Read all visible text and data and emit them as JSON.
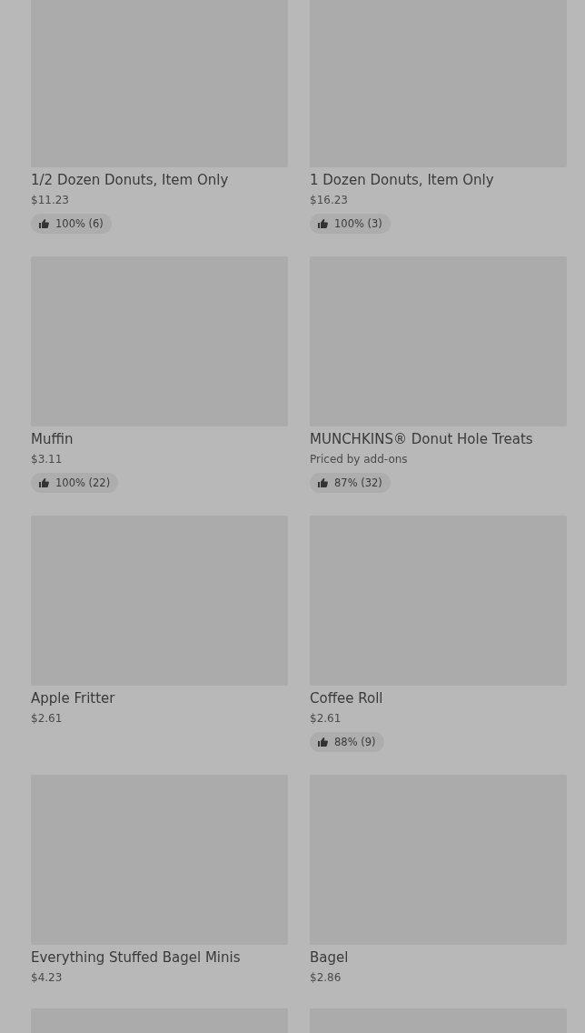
{
  "products": [
    {
      "kind": "product",
      "name": "1/2 Dozen Donuts, Item Only",
      "price": "$11.23",
      "rating": "100% (6)"
    },
    {
      "kind": "product",
      "name": "1 Dozen Donuts, Item Only",
      "price": "$16.23",
      "rating": "100% (3)"
    },
    {
      "kind": "product",
      "name": "Muffin",
      "price": "$3.11",
      "rating": "100% (22)"
    },
    {
      "kind": "product",
      "name": "MUNCHKINS® Donut Hole Treats",
      "price": "Priced by add-ons",
      "rating": "87% (32)"
    },
    {
      "kind": "product",
      "name": "Apple Fritter",
      "price": "$2.61"
    },
    {
      "kind": "product",
      "name": "Coffee Roll",
      "price": "$2.61",
      "rating": "88% (9)"
    },
    {
      "kind": "product",
      "name": "Everything Stuffed Bagel Minis",
      "price": "$4.23"
    },
    {
      "kind": "product",
      "name": "Bagel",
      "price": "$2.86"
    },
    {
      "kind": "image_only"
    },
    {
      "kind": "image_only"
    }
  ]
}
